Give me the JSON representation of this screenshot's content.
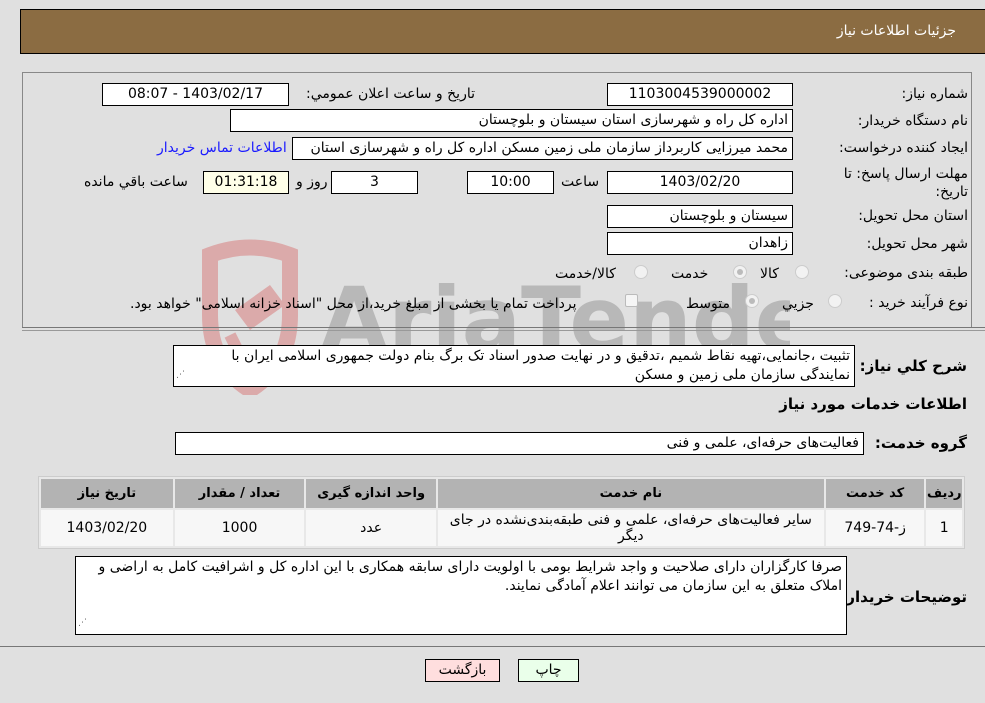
{
  "header": {
    "title": "جزئیات اطلاعات نیاز"
  },
  "fields": {
    "need_number_label": "شماره نیاز:",
    "need_number": "1103004539000002",
    "announce_label": "تاریخ و ساعت اعلان عمومي:",
    "announce_value": "1403/02/17 - 08:07",
    "buyer_org_label": "نام دستگاه خریدار:",
    "buyer_org": "اداره کل راه و شهرسازی استان سیستان و بلوچستان",
    "creator_label": "ایجاد کننده درخواست:",
    "creator": "محمد میرزایی کاربرداز سازمان ملی زمین مسکن اداره کل راه و شهرسازی استان",
    "contact_link": "اطلاعات تماس خریدار",
    "deadline_label": "مهلت ارسال پاسخ: تا تاریخ:",
    "deadline_date": "1403/02/20",
    "time_label": "ساعت",
    "deadline_time": "10:00",
    "days_value": "3",
    "days_label": "روز و",
    "remaining_time": "01:31:18",
    "remaining_label": "ساعت باقي مانده",
    "province_label": "استان محل تحویل:",
    "province": "سیستان و بلوچستان",
    "city_label": "شهر محل تحویل:",
    "city": "زاهدان",
    "category_label": "طبقه بندی موضوعی:",
    "category_options": [
      {
        "label": "کالا",
        "checked": false
      },
      {
        "label": "خدمت",
        "checked": true
      },
      {
        "label": "کالا/خدمت",
        "checked": false
      }
    ],
    "process_label": "نوع فرآیند خرید :",
    "process_options": [
      {
        "label": "جزیي",
        "checked": false
      },
      {
        "label": "متوسط",
        "checked": true
      }
    ],
    "treasury_note": "پرداخت تمام یا بخشی از مبلغ خرید،از محل \"اسناد خزانه اسلامی\" خواهد بود.",
    "treasury_checked": false
  },
  "watermark": {
    "text": "AriaTender.neT"
  },
  "description": {
    "label": "شرح کلي نیاز:",
    "text": "تثبیت ،جانمایی،تهیه نقاط شمیم ،تدقیق و در نهایت صدور اسناد تک برگ بنام دولت جمهوری اسلامی ایران با نمایندگی سازمان ملی زمین و مسکن"
  },
  "services_section": {
    "title": "اطلاعات خدمات مورد نیاز",
    "group_label": "گروه خدمت:",
    "group_value": "فعالیت‌های حرفه‌ای، علمی و فنی"
  },
  "table": {
    "headers": [
      "ردیف",
      "کد خدمت",
      "نام خدمت",
      "واحد اندازه گیری",
      "تعداد / مقدار",
      "تاریخ نیاز"
    ],
    "rows": [
      [
        "1",
        "ز-74-749",
        "سایر فعالیت‌های حرفه‌ای، علمی و فنی طبقه‌بندی‌نشده در جای دیگر",
        "عدد",
        "1000",
        "1403/02/20"
      ]
    ]
  },
  "buyer_notes": {
    "label": "توضیحات خریدار:",
    "text": "صرفا کارگزاران دارای صلاحیت و واجد شرایط بومی با اولویت دارای سابقه همکاری با این اداره کل و اشرافیت کامل به اراضی و املاک متعلق به این سازمان می توانند اعلام آمادگی نمایند."
  },
  "buttons": {
    "print": "چاپ",
    "back": "بازگشت"
  }
}
